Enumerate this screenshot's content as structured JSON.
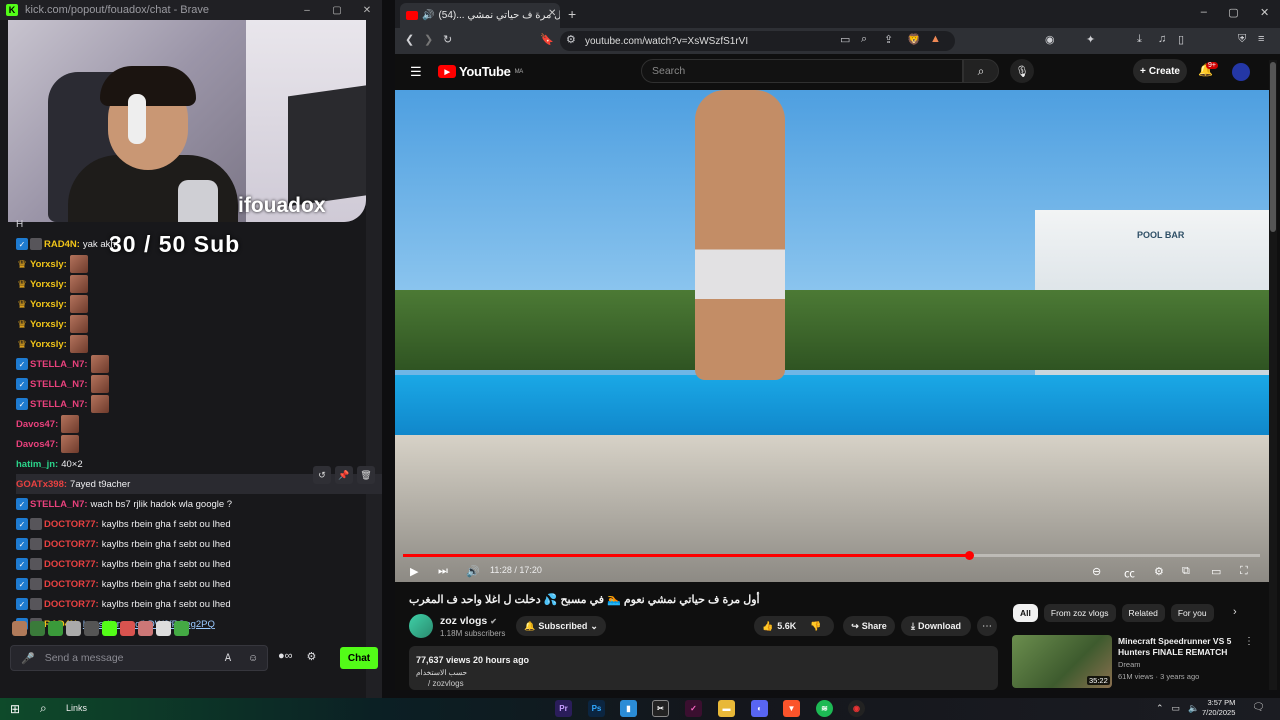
{
  "kick_window": {
    "title": "kick.com/popout/fouadox/chat - Brave",
    "controls": [
      "–",
      "▢",
      "✕"
    ],
    "webcam_name": "ifouadox",
    "sub_goal": "30   / 50 Sub",
    "chat_letter": "H",
    "messages": [
      {
        "user": "RAD4N",
        "text": "yak akh",
        "color": "#f0c419",
        "badge": "ver"
      },
      {
        "user": "Yorxsly",
        "text": "",
        "color": "#f0c419",
        "badge": "crown",
        "emote": true
      },
      {
        "user": "Yorxsly",
        "text": "",
        "color": "#f0c419",
        "badge": "crown",
        "emote": true
      },
      {
        "user": "Yorxsly",
        "text": "",
        "color": "#f0c419",
        "badge": "crown",
        "emote": true
      },
      {
        "user": "Yorxsly",
        "text": "",
        "color": "#f0c419",
        "badge": "crown",
        "emote": true
      },
      {
        "user": "Yorxsly",
        "text": "",
        "color": "#f0c419",
        "badge": "crown",
        "emote": true
      },
      {
        "user": "STELLA_N7",
        "text": "",
        "color": "#e8417c",
        "badge": "ver",
        "emote": true
      },
      {
        "user": "STELLA_N7",
        "text": "",
        "color": "#e8417c",
        "badge": "ver",
        "emote": true
      },
      {
        "user": "STELLA_N7",
        "text": "",
        "color": "#e8417c",
        "badge": "ver",
        "emote": true
      },
      {
        "user": "Davos47",
        "text": "",
        "color": "#e8417c",
        "badge": "",
        "emote": true
      },
      {
        "user": "Davos47",
        "text": "",
        "color": "#e8417c",
        "badge": "",
        "emote": true
      },
      {
        "user": "hatim_jn",
        "text": "40×2",
        "color": "#2bd48a",
        "badge": ""
      },
      {
        "user": "GOATx398",
        "text": "7ayed t9acher",
        "color": "#e84141",
        "badge": "",
        "highlight": true
      },
      {
        "user": "STELLA_N7",
        "text": "wach bs7 rjlik hadok wla google ?",
        "color": "#e8417c",
        "badge": "ver"
      },
      {
        "user": "DOCTOR77",
        "text": "kaylbs rbein gha f sebt ou lhed",
        "color": "#e84141",
        "badge": "ver-av"
      },
      {
        "user": "DOCTOR77",
        "text": "kaylbs rbein gha f sebt ou lhed",
        "color": "#e84141",
        "badge": "ver-av"
      },
      {
        "user": "DOCTOR77",
        "text": "kaylbs rbein gha f sebt ou lhed",
        "color": "#e84141",
        "badge": "ver-av"
      },
      {
        "user": "DOCTOR77",
        "text": "kaylbs rbein gha f sebt ou lhed",
        "color": "#e84141",
        "badge": "ver-av"
      },
      {
        "user": "DOCTOR77",
        "text": "kaylbs rbein gha f sebt ou lhed",
        "color": "#e84141",
        "badge": "ver-av"
      },
      {
        "user": "RAD4N",
        "text": "https://prnt.sc/LDW6fPOeg2PQ",
        "color": "#f0c419",
        "badge": "ver-av",
        "link": true
      }
    ],
    "input_placeholder": "Send a message",
    "chat_button": "Chat",
    "accent": "#53fc18"
  },
  "brave_window": {
    "tab_title": "أول مرة ف حياتي نمشي ...(54)",
    "url": "youtube.com/watch?v=XsWSzfS1rVI",
    "search_placeholder": "Search",
    "logo_text": "YouTube",
    "logo_region": "MA",
    "create_label": "Create",
    "bell_badge": "9+",
    "pool_sign": "POOL BAR",
    "time_display": "11:28 / 17:20",
    "progress_fraction": 0.66,
    "video_title": "أول مرة ف حياتي نمشي نعوم 🏊 في مسبح 💦 دخلت ل اغلا واحد ف المغرب",
    "channel_name": "zoz vlogs",
    "channel_subs": "1.18M subscribers",
    "subscribed_label": "Subscribed",
    "like_count": "5.6K",
    "share_label": "Share",
    "download_label": "Download",
    "views_line": "77,637 views  20 hours ago",
    "desc_line": "حسب الاستخدام",
    "desc_tag": "/ zozvlogs",
    "chips": [
      "All",
      "From zoz vlogs",
      "Related",
      "For you"
    ],
    "rec_title": "Minecraft Speedrunner VS 5 Hunters FINALE REMATCH",
    "rec_channel": "Dream",
    "rec_meta": "61M views · 3 years ago",
    "rec_duration": "35:22",
    "yt_red": "#ff0000"
  },
  "taskbar": {
    "links_label": "Links",
    "time": "3:57 PM",
    "date": "7/20/2025"
  }
}
